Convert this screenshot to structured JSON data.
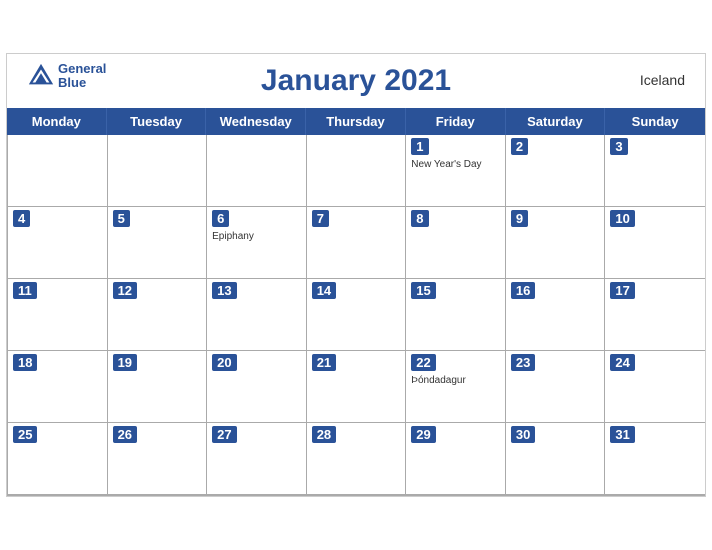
{
  "header": {
    "title": "January 2021",
    "country": "Iceland",
    "logo_line1": "General",
    "logo_line2": "Blue"
  },
  "days_of_week": [
    "Monday",
    "Tuesday",
    "Wednesday",
    "Thursday",
    "Friday",
    "Saturday",
    "Sunday"
  ],
  "weeks": [
    [
      {
        "num": "",
        "holiday": ""
      },
      {
        "num": "",
        "holiday": ""
      },
      {
        "num": "",
        "holiday": ""
      },
      {
        "num": "",
        "holiday": ""
      },
      {
        "num": "1",
        "holiday": "New Year's Day"
      },
      {
        "num": "2",
        "holiday": ""
      },
      {
        "num": "3",
        "holiday": ""
      }
    ],
    [
      {
        "num": "4",
        "holiday": ""
      },
      {
        "num": "5",
        "holiday": ""
      },
      {
        "num": "6",
        "holiday": "Epiphany"
      },
      {
        "num": "7",
        "holiday": ""
      },
      {
        "num": "8",
        "holiday": ""
      },
      {
        "num": "9",
        "holiday": ""
      },
      {
        "num": "10",
        "holiday": ""
      }
    ],
    [
      {
        "num": "11",
        "holiday": ""
      },
      {
        "num": "12",
        "holiday": ""
      },
      {
        "num": "13",
        "holiday": ""
      },
      {
        "num": "14",
        "holiday": ""
      },
      {
        "num": "15",
        "holiday": ""
      },
      {
        "num": "16",
        "holiday": ""
      },
      {
        "num": "17",
        "holiday": ""
      }
    ],
    [
      {
        "num": "18",
        "holiday": ""
      },
      {
        "num": "19",
        "holiday": ""
      },
      {
        "num": "20",
        "holiday": ""
      },
      {
        "num": "21",
        "holiday": ""
      },
      {
        "num": "22",
        "holiday": "Þóndadagur"
      },
      {
        "num": "23",
        "holiday": ""
      },
      {
        "num": "24",
        "holiday": ""
      }
    ],
    [
      {
        "num": "25",
        "holiday": ""
      },
      {
        "num": "26",
        "holiday": ""
      },
      {
        "num": "27",
        "holiday": ""
      },
      {
        "num": "28",
        "holiday": ""
      },
      {
        "num": "29",
        "holiday": ""
      },
      {
        "num": "30",
        "holiday": ""
      },
      {
        "num": "31",
        "holiday": ""
      }
    ]
  ],
  "colors": {
    "header_bg": "#2a5298",
    "header_text": "#ffffff",
    "title_color": "#2a5298"
  }
}
